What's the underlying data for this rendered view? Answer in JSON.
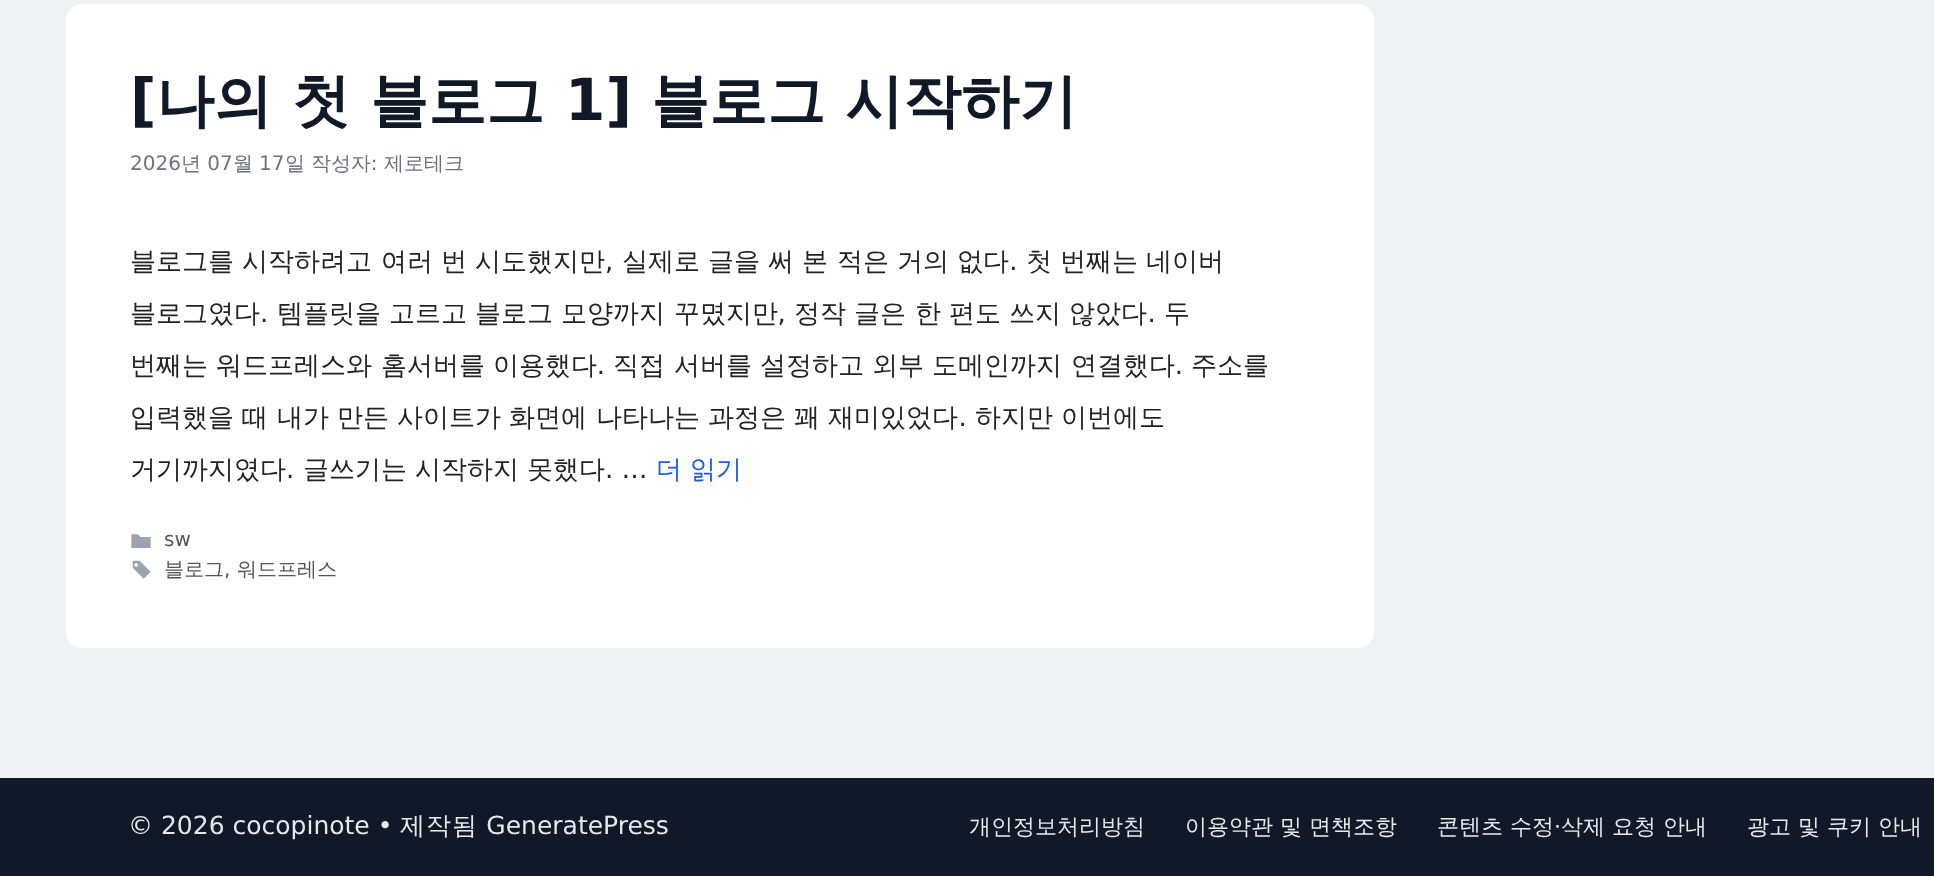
{
  "post": {
    "title": "[나의 첫 블로그 1] 블로그 시작하기",
    "meta": "2026년 07월 17일 작성자: 제로테크",
    "excerpt_lines": [
      "블로그를 시작하려고 여러 번 시도했지만, 실제로 글을 써 본 적은 거의 없다. 첫 번째는 네이버",
      "블로그였다. 템플릿을 고르고 블로그 모양까지 꾸몄지만, 정작 글은 한 편도 쓰지 않았다. 두",
      "번째는 워드프레스와 홈서버를 이용했다. 직접 서버를 설정하고 외부 도메인까지 연결했다. 주소를",
      "입력했을 때 내가 만든 사이트가 화면에 나타나는 과정은 꽤 재미있었다. 하지만 이번에도",
      "거기까지였다. 글쓰기는 시작하지 못했다. …"
    ],
    "read_more": "더 읽기",
    "category": "sw",
    "tags": "블로그, 워드프레스"
  },
  "footer": {
    "copyright": "© 2026 cocopinote • 제작됨 GeneratePress",
    "links": [
      "개인정보처리방침",
      "이용약관 및 면책조항",
      "콘텐츠 수정·삭제 요청 안내",
      "광고 및 쿠키 안내"
    ]
  }
}
